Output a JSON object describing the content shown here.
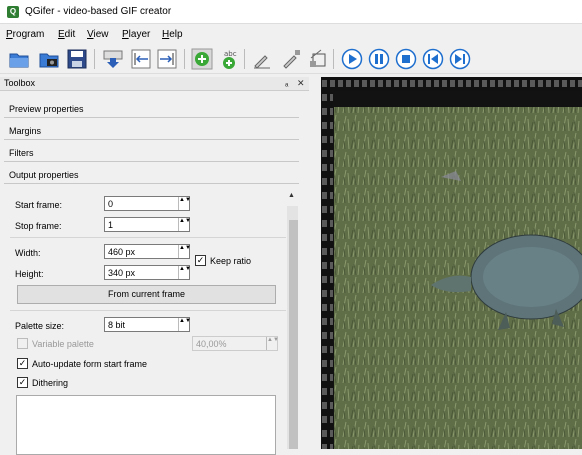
{
  "window": {
    "title": "QGifer - video-based GIF creator",
    "icon_letter": "Q"
  },
  "menu": [
    {
      "label": "Program",
      "underline": "P"
    },
    {
      "label": "Edit",
      "underline": "E"
    },
    {
      "label": "View",
      "underline": "V"
    },
    {
      "label": "Player",
      "underline": "P"
    },
    {
      "label": "Help",
      "underline": "H"
    }
  ],
  "toolbar_icons": [
    "open-folder-icon",
    "open-video-icon",
    "save-icon",
    "extract-icon",
    "set-start-icon",
    "set-end-icon",
    "add-object-icon",
    "add-text-icon",
    "edit-icon",
    "edit-2-icon",
    "crop-icon",
    "play-icon",
    "pause-icon",
    "stop-icon",
    "prev-frame-icon",
    "next-frame-icon"
  ],
  "dock": {
    "title": "Toolbox",
    "pin": "ₐ",
    "close": "✕"
  },
  "sections": [
    "Preview properties",
    "Margins",
    "Filters",
    "Output properties"
  ],
  "output": {
    "start_frame_label": "Start frame:",
    "start_frame_value": "0",
    "stop_frame_label": "Stop frame:",
    "stop_frame_value": "1",
    "width_label": "Width:",
    "width_value": "460 px",
    "height_label": "Height:",
    "height_value": "340 px",
    "keep_ratio_label": "Keep ratio",
    "from_current_frame": "From current frame",
    "palette_size_label": "Palette size:",
    "palette_size_value": "8 bit",
    "variable_palette_label": "Variable palette",
    "variable_palette_value": "40,00%",
    "auto_update_label": "Auto-update form start frame",
    "dithering_label": "Dithering"
  },
  "checkmark": "✓",
  "scroll_up_arrow": "▲",
  "spin_arrows": "▲▼",
  "colors": {
    "play_blue": "#1f6fcf",
    "add_green": "#3aa836"
  }
}
